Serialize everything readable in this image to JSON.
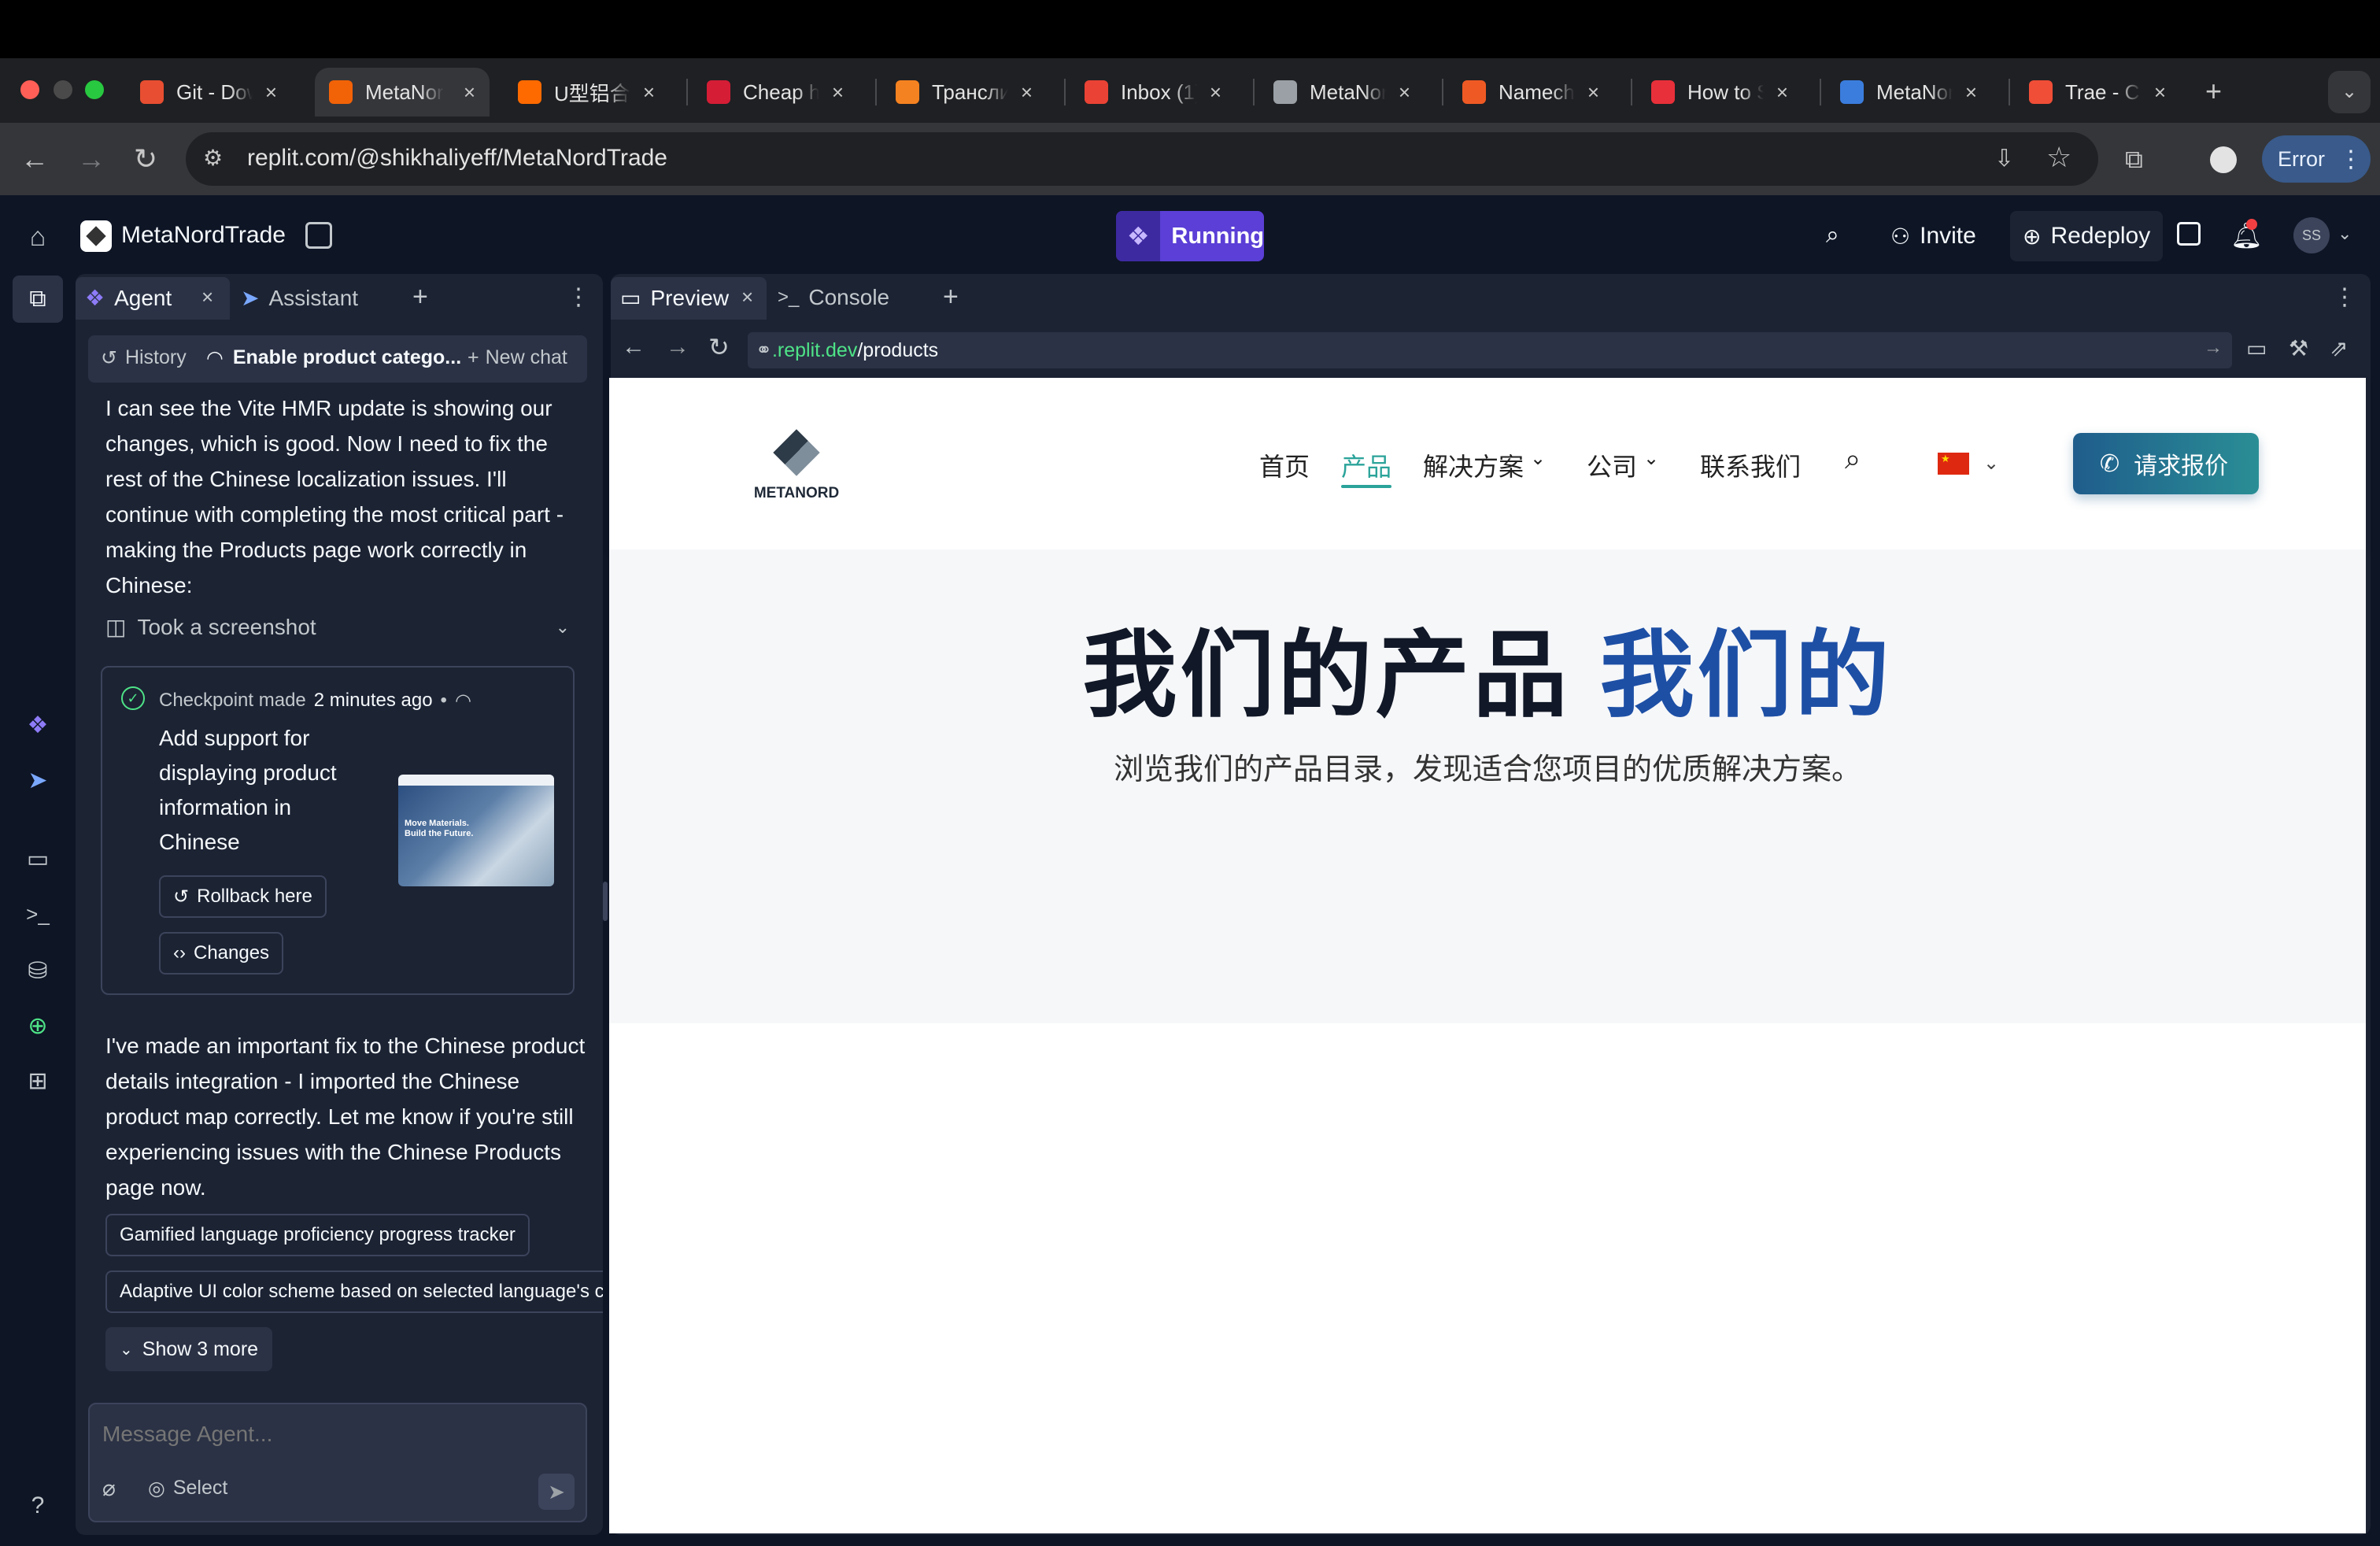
{
  "browser": {
    "tabs": [
      {
        "label": "Git - Dow",
        "favicon_color": "#e84e31",
        "icon": "git-icon"
      },
      {
        "label": "MetaNor",
        "favicon_color": "#f26207",
        "icon": "replit-icon",
        "active": true
      },
      {
        "label": "U型铝合",
        "favicon_color": "#ff6a00",
        "icon": "alibaba-icon"
      },
      {
        "label": "Cheap h",
        "favicon_color": "#d51d36",
        "icon": "h-icon"
      },
      {
        "label": "Трансли",
        "favicon_color": "#f58220",
        "icon": "translit-icon"
      },
      {
        "label": "Inbox (1)",
        "favicon_color": "#ea4335",
        "icon": "gmail-icon"
      },
      {
        "label": "MetaNor",
        "favicon_color": "#9aa0a6",
        "icon": "globe-icon"
      },
      {
        "label": "Namech",
        "favicon_color": "#ef5a24",
        "icon": "namecheap-icon"
      },
      {
        "label": "How to S",
        "favicon_color": "#e8303a",
        "icon": "target-icon"
      },
      {
        "label": "MetaNor",
        "favicon_color": "#3b7ddd",
        "icon": "metanord-icon"
      },
      {
        "label": "Trae - C",
        "favicon_color": "#f04e37",
        "icon": "trae-icon"
      }
    ],
    "url": "replit.com/@shikhaliyeff/MetaNordTrade",
    "error_label": "Error"
  },
  "topbar": {
    "project_name": "MetaNordTrade",
    "run_label": "Running",
    "invite_label": "Invite",
    "redeploy_label": "Redeploy",
    "avatar_initials": "SS"
  },
  "agent": {
    "tabs": [
      "Agent",
      "Assistant"
    ],
    "history_label": "History",
    "current_chat": "Enable product catego...",
    "new_chat_label": "New chat",
    "message1": "I can see the Vite HMR update is showing our changes, which is good. Now I need to fix the rest of the Chinese localization issues. I'll continue with completing the most critical part - making the Products page work correctly in Chinese:",
    "screenshot_label": "Took a screenshot",
    "checkpoint": {
      "label": "Checkpoint made",
      "time": "2 minutes ago",
      "description": "Add support for displaying product information in Chinese",
      "rollback_label": "Rollback here",
      "changes_label": "Changes",
      "thumb_text": "Move Materials. Build the Future."
    },
    "message2": "I've made an important fix to the Chinese product details integration - I imported the Chinese product map correctly. Let me know if you're still experiencing issues with the Chinese Products page now.",
    "suggestions": [
      "Gamified language proficiency progress tracker",
      "Adaptive UI color scheme based on selected language's c"
    ],
    "show_more_label": "Show 3 more",
    "input_placeholder": "Message Agent...",
    "select_label": "Select"
  },
  "preview": {
    "tabs": [
      "Preview",
      "Console"
    ],
    "url_host": ".replit.dev",
    "url_path": "/products",
    "site": {
      "logo_text": "METANORD",
      "nav": [
        "首页",
        "产品",
        "解决方案",
        "公司",
        "联系我们"
      ],
      "active_nav": "产品",
      "cta_label": "请求报价",
      "hero_title": "我们的产品",
      "hero_title_accent": "我们的",
      "hero_subtitle": "浏览我们的产品目录，发现适合您项目的优质解决方案。"
    }
  },
  "colors": {
    "app_bg": "#0e1525",
    "panel_bg": "#1c2333",
    "run_button": "#5b3fd6",
    "site_accent": "#1d4fa5",
    "cta_bg": "#1f5d8c",
    "nav_active": "#2ba39a"
  }
}
